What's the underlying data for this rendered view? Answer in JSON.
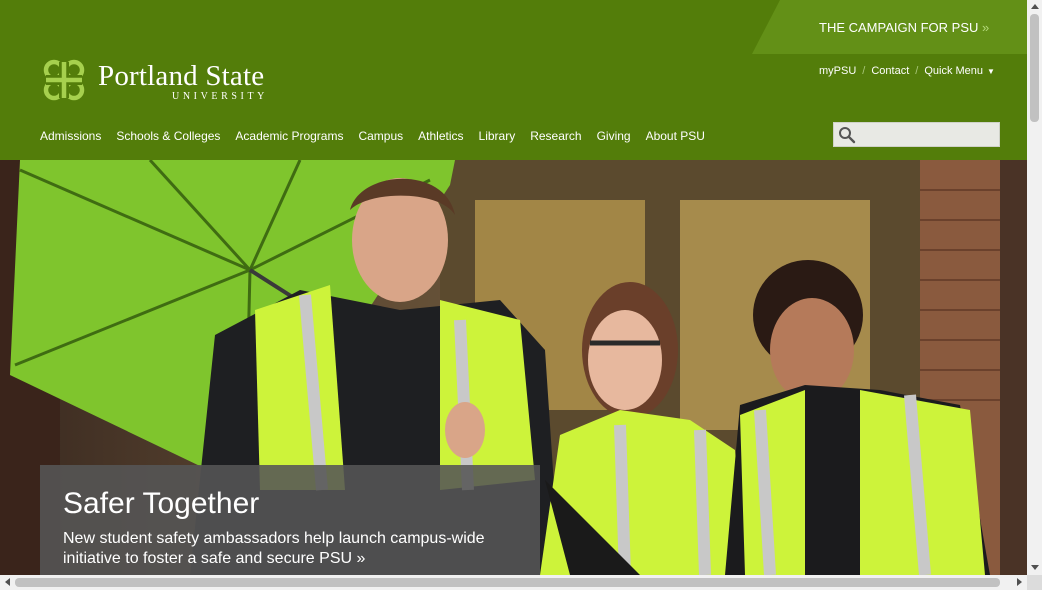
{
  "header": {
    "campaign_link": "THE CAMPAIGN FOR PSU",
    "campaign_arrow": "»",
    "logo_name": "Portland State",
    "logo_sub": "UNIVERSITY",
    "utility": {
      "mypsu": "myPSU",
      "separator": "/",
      "contact": "Contact",
      "quick_menu": "Quick Menu",
      "quick_menu_caret": "▼"
    },
    "nav": [
      "Admissions",
      "Schools & Colleges",
      "Academic Programs",
      "Campus",
      "Athletics",
      "Library",
      "Research",
      "Giving",
      "About PSU"
    ],
    "search": {
      "placeholder": "",
      "icon": "search-icon"
    }
  },
  "hero": {
    "title": "Safer Together",
    "text": "New student safety ambassadors help launch campus-wide initiative to foster a safe and secure PSU »"
  },
  "colors": {
    "header_green": "#537d0a",
    "campaign_tab": "#639017",
    "logo_mark": "#a6d04e",
    "caption_bg": "#555555"
  }
}
